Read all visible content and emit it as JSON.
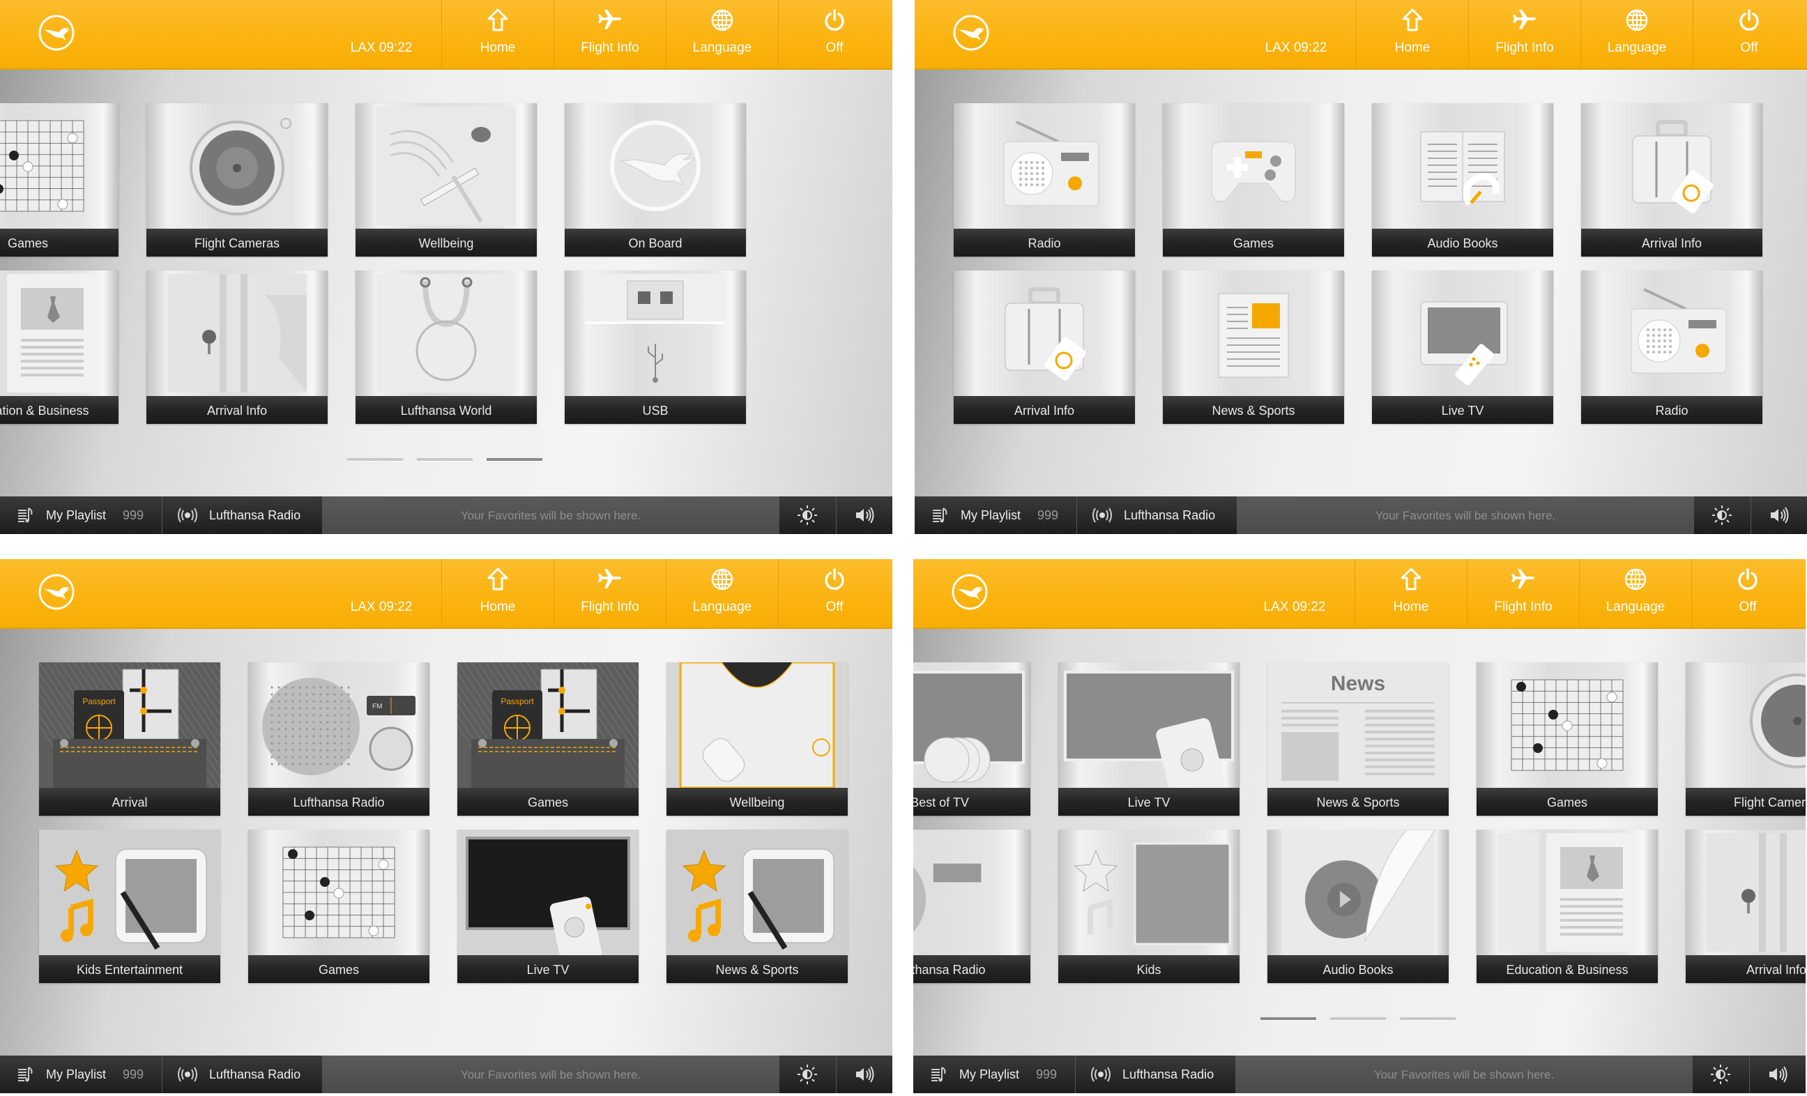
{
  "header": {
    "clock": "LAX 09:22",
    "nav": [
      {
        "label": "Home",
        "icon": "home-icon"
      },
      {
        "label": "Flight Info",
        "icon": "airplane-icon"
      },
      {
        "label": "Language",
        "icon": "globe-icon"
      },
      {
        "label": "Off",
        "icon": "power-icon"
      }
    ]
  },
  "bottombar": {
    "playlist_label": "My Playlist",
    "playlist_count": "999",
    "radio_label": "Lufthansa Radio",
    "favorites_placeholder": "Your Favorites will be shown here."
  },
  "colors": {
    "brand": "#fbb30f",
    "tile_band": "#242424",
    "accent": "#f6a800"
  },
  "panels": [
    {
      "id": "panel-a",
      "pager": {
        "count": 3,
        "active": 3
      },
      "tiles": [
        [
          "Games",
          "Flight Cameras",
          "Wellbeing",
          "On Board"
        ],
        [
          "Education & Business",
          "Arrival Info",
          "Lufthansa World",
          "USB"
        ]
      ]
    },
    {
      "id": "panel-b",
      "pager": null,
      "tiles": [
        [
          "Radio",
          "Games",
          "Audio Books",
          "Arrival Info"
        ],
        [
          "Arrival Info",
          "News & Sports",
          "Live TV",
          "Radio"
        ]
      ]
    },
    {
      "id": "panel-c",
      "pager": null,
      "tiles": [
        [
          "Arrival",
          "Lufthansa Radio",
          "Games",
          "Wellbeing"
        ],
        [
          "Kids Entertainment",
          "Games",
          "Live TV",
          "News & Sports"
        ]
      ]
    },
    {
      "id": "panel-d",
      "pager": {
        "count": 3,
        "active": 1
      },
      "tiles": [
        [
          "Best of TV",
          "Live TV",
          "News & Sports",
          "Games",
          "Flight Cameras"
        ],
        [
          "Lufthansa Radio",
          "Kids",
          "Audio Books",
          "Education & Business",
          "Arrival Info"
        ]
      ]
    }
  ],
  "tile_art_text": {
    "news": "News",
    "passport": "Passport",
    "fm": "FM"
  }
}
